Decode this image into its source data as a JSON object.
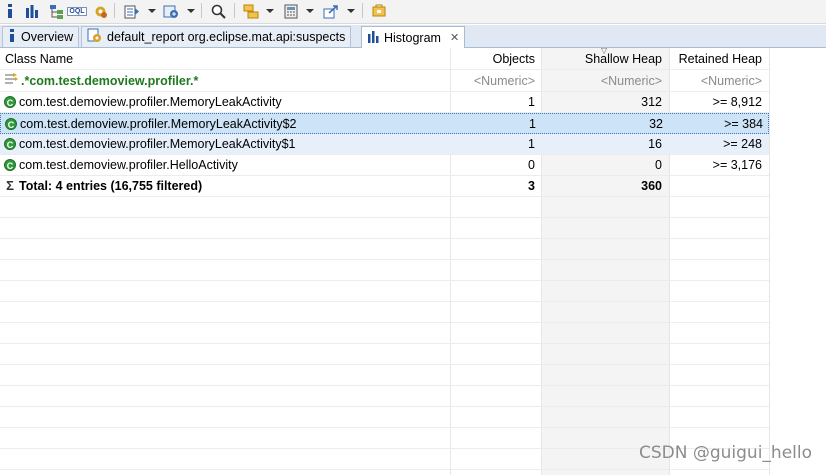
{
  "toolbar": {
    "icons": [
      "info-icon",
      "bar-chart-icon",
      "dominator-tree-icon",
      "oql-icon",
      "gear-icon",
      "query-browser-icon",
      "heap-dump-overview-icon",
      "search-icon",
      "group-by-icon",
      "calculator-icon",
      "export-icon",
      "pin-icon"
    ],
    "oql_label": "OQL"
  },
  "tabs": [
    {
      "label": "Overview",
      "icon": "info-icon"
    },
    {
      "label": "default_report  org.eclipse.mat.api:suspects",
      "icon": "report-icon"
    },
    {
      "label": "Histogram",
      "icon": "histogram-icon",
      "active": true
    }
  ],
  "table": {
    "headers": {
      "class_name": "Class Name",
      "objects": "Objects",
      "shallow": "Shallow Heap",
      "retained": "Retained Heap"
    },
    "filter": {
      "class_name": ".*com.test.demoview.profiler.*",
      "objects": "<Numeric>",
      "shallow": "<Numeric>",
      "retained": "<Numeric>"
    },
    "rows": [
      {
        "class_name": "com.test.demoview.profiler.MemoryLeakActivity",
        "objects": "1",
        "shallow": "312",
        "retained": ">= 8,912"
      },
      {
        "class_name": "com.test.demoview.profiler.MemoryLeakActivity$2",
        "objects": "1",
        "shallow": "32",
        "retained": ">= 384"
      },
      {
        "class_name": "com.test.demoview.profiler.MemoryLeakActivity$1",
        "objects": "1",
        "shallow": "16",
        "retained": ">= 248"
      },
      {
        "class_name": "com.test.demoview.profiler.HelloActivity",
        "objects": "0",
        "shallow": "0",
        "retained": ">= 3,176"
      }
    ],
    "total": {
      "label": "Total: 4 entries (16,755 filtered)",
      "objects": "3",
      "shallow": "360",
      "retained": ""
    },
    "class_badge": "C",
    "total_symbol": "Σ"
  },
  "watermark": "CSDN @guigui_hello",
  "colors": {
    "filter_text": "#1f7a1f",
    "class_icon": "#2f9a3b",
    "selection": "#cde3f7"
  }
}
